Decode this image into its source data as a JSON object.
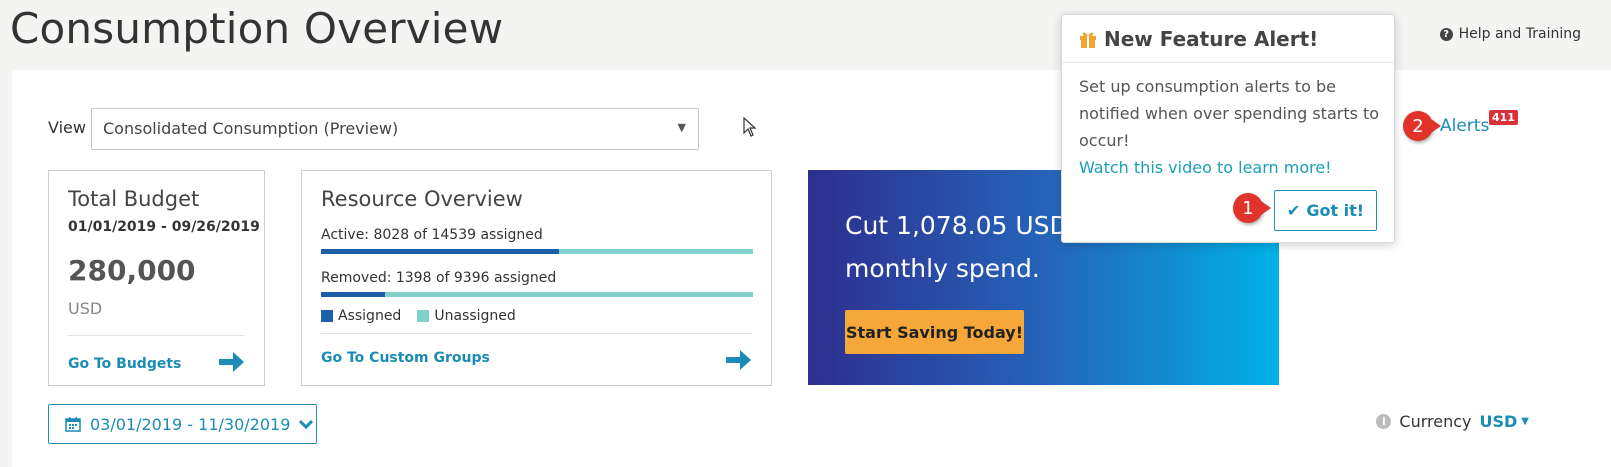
{
  "header": {
    "title": "Consumption Overview",
    "help_label": "Help and Training",
    "help_icon": "question-circle-icon"
  },
  "view": {
    "label": "View",
    "selected": "Consolidated Consumption (Preview)"
  },
  "budget_card": {
    "title": "Total Budget",
    "date_range": "01/01/2019 - 09/26/2019",
    "amount": "280,000",
    "currency": "USD",
    "link": "Go To Budgets"
  },
  "resource_card": {
    "title": "Resource Overview",
    "active_text": "Active: 8028 of 14539 assigned",
    "active_ratio": 0.552,
    "removed_text": "Removed: 1398 of 9396 assigned",
    "removed_ratio": 0.149,
    "legend_assigned": "Assigned",
    "legend_unassigned": "Unassigned",
    "link": "Go To Custom Groups",
    "colors": {
      "assigned": "#1a5fa8",
      "unassigned": "#7fd1ca"
    }
  },
  "promo": {
    "text": "Cut 1,078.05 USD from your monthly spend.",
    "button": "Start Saving Today!"
  },
  "feature_alert": {
    "title": "New Feature Alert!",
    "body": "Set up consumption alerts to be notified when over spending starts to occur!",
    "link": "Watch this video to learn more!",
    "button": "Got it!",
    "icon": "gift-icon"
  },
  "alerts": {
    "label": "Alerts",
    "count": "411"
  },
  "steps": {
    "one": "1",
    "two": "2"
  },
  "date_filter": {
    "value": "03/01/2019 - 11/30/2019"
  },
  "currency": {
    "label": "Currency",
    "value": "USD"
  },
  "colors": {
    "accent": "#1a8cb5",
    "promo_button": "#f6a73a",
    "badge_red": "#e0332b"
  }
}
